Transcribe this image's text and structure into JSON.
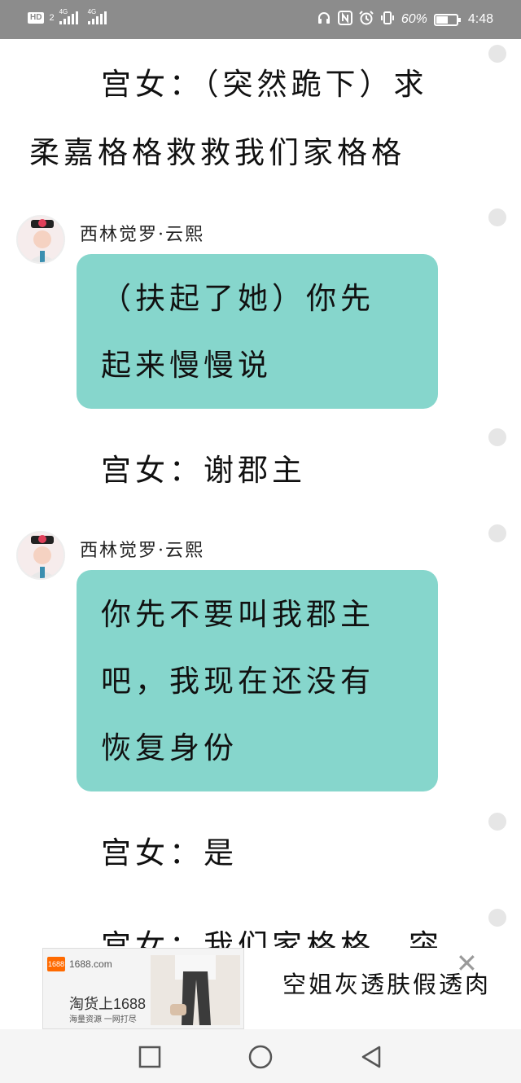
{
  "status_bar": {
    "hd": "HD",
    "sim": "2",
    "net1": "4G",
    "net2": "4G",
    "battery_percent": "60%",
    "battery_level": 0.6,
    "time": "4:48"
  },
  "chat": {
    "narration_1_line1": "宫女：（突然跪下）求",
    "narration_1_line2": "柔嘉格格救救我们家格格",
    "speaker_1": "西林觉罗·云熙",
    "bubble_1_line1": "（扶起了她）你先",
    "bubble_1_line2": "起来慢慢说",
    "narration_2": "宫女：谢郡主",
    "speaker_2": "西林觉罗·云熙",
    "bubble_2_line1": "你先不要叫我郡主",
    "bubble_2_line2": "吧，我现在还没有",
    "bubble_2_line3": "恢复身份",
    "narration_3": "宫女：是",
    "narration_4_partial": "宫女：我们家格格，突"
  },
  "ad": {
    "logo": "1688",
    "site": "1688.com",
    "slogan": "淘货上1688",
    "sub": "海量资源 一网打尽",
    "text": "空姐灰透肤假透肉"
  },
  "colors": {
    "status_bar": "#8c8c8c",
    "bubble": "#86d6cc",
    "background": "#ffffff"
  },
  "icons": [
    "headphones-icon",
    "nfc-icon",
    "alarm-icon",
    "vibrate-icon",
    "battery-icon",
    "close-icon",
    "recent-apps-icon",
    "home-icon",
    "back-icon"
  ]
}
